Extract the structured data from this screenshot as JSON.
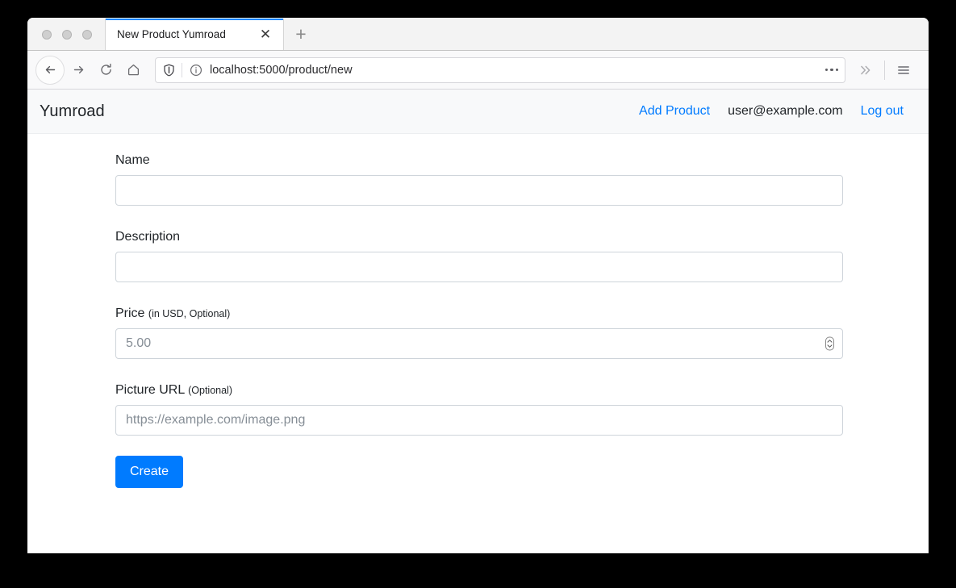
{
  "browser": {
    "window_controls": [
      "close",
      "minimize",
      "maximize"
    ],
    "tab": {
      "title": "New Product Yumroad",
      "close_label": "✕",
      "new_tab_label": "+"
    },
    "toolbar": {
      "back_icon": "back-arrow-icon",
      "forward_icon": "forward-arrow-icon",
      "reload_icon": "reload-icon",
      "home_icon": "home-icon",
      "shield_icon": "shield-icon",
      "info_icon": "info-circle-icon",
      "page_actions_icon": "ellipsis-icon",
      "overflow_label": "»",
      "menu_icon": "hamburger-menu-icon",
      "url": "localhost:5000/product/new"
    }
  },
  "app": {
    "brand": "Yumroad",
    "nav": {
      "add_product": "Add Product",
      "user_email": "user@example.com",
      "log_out": "Log out"
    },
    "accent_color": "#007bff",
    "navbar_bg": "#f8f9fa"
  },
  "form": {
    "name": {
      "label": "Name",
      "value": "",
      "placeholder": ""
    },
    "description": {
      "label": "Description",
      "value": "",
      "placeholder": ""
    },
    "price": {
      "label": "Price",
      "hint": "(in USD, Optional)",
      "value": "5.00",
      "placeholder": "5.00",
      "spinner_icon": "number-stepper-icon"
    },
    "picture_url": {
      "label": "Picture URL",
      "hint": "(Optional)",
      "value": "",
      "placeholder": "https://example.com/image.png"
    },
    "submit_label": "Create"
  }
}
